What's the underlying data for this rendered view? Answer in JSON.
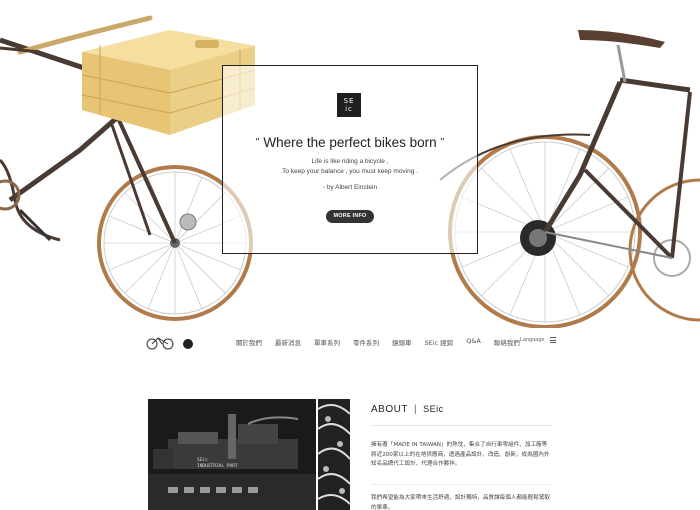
{
  "hero": {
    "logo_line1": "SE",
    "logo_line2": "ic",
    "title": "Where the perfect bikes born",
    "title_quote_open": "\"",
    "title_quote_close": "\"",
    "quote_line1": "Life is like riding a bicycle ,",
    "quote_line2": "To keep your balance , you must keep moving .",
    "attribution": "- by Albert Einstein",
    "more_button": "MORE INFO"
  },
  "nav": {
    "items": [
      {
        "label": "關於我們"
      },
      {
        "label": "最新消息"
      },
      {
        "label": "單車系列"
      },
      {
        "label": "零件系列"
      },
      {
        "label": "鏡頭車"
      },
      {
        "label": "SEic 經銷"
      },
      {
        "label": "Q&A"
      },
      {
        "label": "聯絡我們"
      }
    ],
    "language": "Language",
    "menu_icon": "menu-icon"
  },
  "about": {
    "heading": "ABOUT",
    "separator": "|",
    "brand": "SEic",
    "photo_caption_line1": "SEic",
    "photo_caption_line2": "INDUSTRIAL PART",
    "paragraph1": "擁有著「MADE IN TAIWAN」的熱忱，集合了自行車零組件、加工廠等將近200家以上的在地供應商，透過產品設計、改造、創新，成為國內外知名品牌代工設計、代理合作夥伴。",
    "paragraph2": "我們希望能為大家帶來生活舒適，設計獨特，品質讓每個人都能輕鬆駕馭的單車。"
  },
  "colors": {
    "accent_dark": "#222222",
    "button_bg": "#333333",
    "wood": "#e9c97a",
    "tire": "#b07a4a",
    "frame": "#4a3a34"
  }
}
